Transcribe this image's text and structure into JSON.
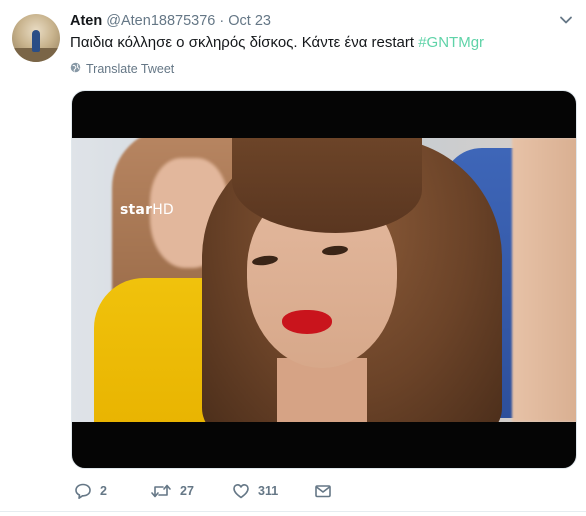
{
  "tweet": {
    "author_name": "Aten",
    "handle": "@Aten18875376",
    "separator": "·",
    "date": "Oct 23",
    "text": "Παιδια κόλλησε ο σκληρός δίσκος. Κάντε ένα restart",
    "hashtag": "#GNTMgr",
    "translate_label": "Translate Tweet",
    "media": {
      "logo_main": "star",
      "logo_hd": "HD"
    },
    "actions": {
      "reply_count": "2",
      "retweet_count": "27",
      "like_count": "311"
    }
  },
  "icons": {
    "caret": "chevron-down-icon",
    "globe": "globe-icon",
    "reply": "reply-icon",
    "retweet": "retweet-icon",
    "like": "heart-icon",
    "dm": "envelope-icon"
  },
  "colors": {
    "hashtag": "#5fd3a8",
    "secondary_text": "#657786",
    "primary_text": "#14171a"
  }
}
